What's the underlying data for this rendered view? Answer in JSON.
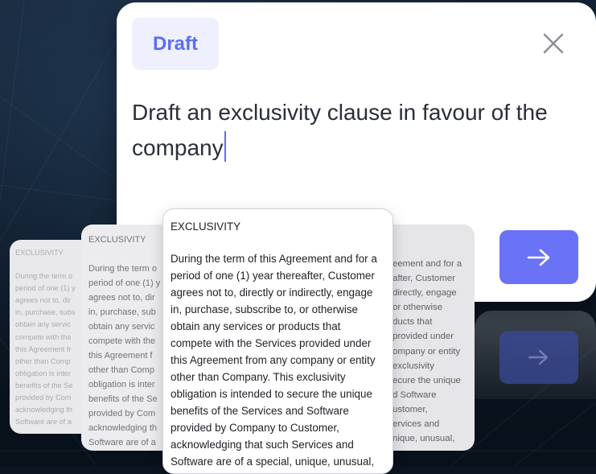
{
  "badge": {
    "label": "Draft"
  },
  "prompt": {
    "text": "Draft an exclusivity clause in favour of the company"
  },
  "icons": {
    "close": "close-icon",
    "send": "arrow-right-icon"
  },
  "colors": {
    "accent": "#6a72f5",
    "badge_text": "#5b6ef0",
    "badge_bg": "#eef0fd"
  },
  "documents": {
    "heading": "EXCLUSIVITY",
    "front_body": "During the term of this Agreement and for a\nperiod of one (1) year thereafter, Customer\nagrees not to, directly or indirectly, engage\nin, purchase, subscribe to, or otherwise\nobtain any services or products that\ncompete with the Services provided under\nthis Agreement from any company or entity\nother than Company. This exclusivity\nobligation is intended to secure the unique\nbenefits of the Services and Software\nprovided by Company to Customer,\nacknowledging that such Services and\nSoftware are of a special, unique, unusual,",
    "left_body": "During the term o\nperiod of one (1) y\nagrees not to, dir\nin, purchase, sub\nobtain any servic\ncompete with the\nthis Agreement f\nother than Comp\nobligation is inter\nbenefits of the Se\nprovided by Com\nacknowledging th\nSoftware are of a",
    "far_left_body": "During the term o\nperiod of one (1) y\nagrees not to, dir\nin, purchase, subs\nobtain any servic\ncompete with the\nthis Agreement fr\nother than Comp\nobligation is inter\nbenefits of the Se\nprovided by Com\nacknowledging th\nSoftware are of a",
    "right_body": "eement and for a\nafter, Customer\ndirectly, engage\nor otherwise\nducts that\nprovided under\nompany or entity\nexclusivity\necure the unique\nd Software\nustomer,\nervices and\nnique, unusual,"
  }
}
